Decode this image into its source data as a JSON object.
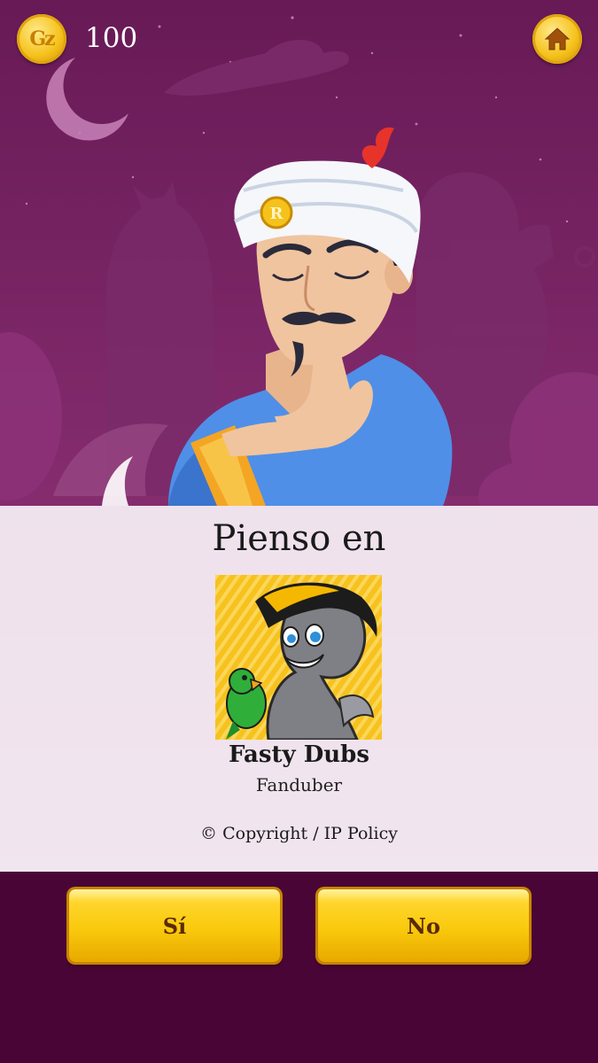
{
  "hud": {
    "coin_label": "Gz",
    "coin_count": "100"
  },
  "icons": {
    "coin": "coin-icon",
    "home": "home-icon"
  },
  "result": {
    "title": "Pienso en",
    "name": "Fasty Dubs",
    "description": "Fanduber",
    "copyright_link": "© Copyright / IP Policy"
  },
  "buttons": {
    "yes": "Sí",
    "no": "No"
  },
  "colors": {
    "background": "#6b1b57",
    "panel": "#f6f0f6",
    "button": "#f9c90c",
    "bottom_bar": "#490535"
  }
}
